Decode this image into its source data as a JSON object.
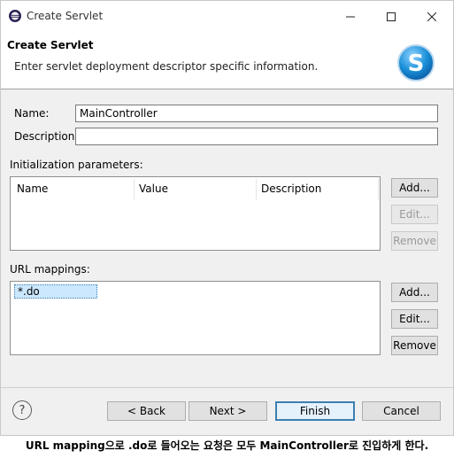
{
  "window": {
    "title": "Create Servlet",
    "controls": {
      "minimize": "—",
      "maximize": "☐",
      "close": "✕"
    }
  },
  "banner": {
    "title": "Create Servlet",
    "description": "Enter servlet deployment descriptor specific information.",
    "logo_letter": "S"
  },
  "form": {
    "name_label": "Name:",
    "name_value": "MainController",
    "description_label": "Description:",
    "description_value": ""
  },
  "init_params": {
    "label": "Initialization parameters:",
    "columns": [
      "Name",
      "Value",
      "Description"
    ],
    "buttons": {
      "add": "Add...",
      "edit": "Edit...",
      "remove": "Remove"
    }
  },
  "url_mappings": {
    "label": "URL mappings:",
    "items": [
      "*.do"
    ],
    "buttons": {
      "add": "Add...",
      "edit": "Edit...",
      "remove": "Remove"
    }
  },
  "footer": {
    "help": "?",
    "back": "< Back",
    "next": "Next >",
    "finish": "Finish",
    "cancel": "Cancel"
  },
  "caption": "URL mapping으로 .do로 들어오는 요청은 모두 MainController로 진입하게 한다.",
  "colors": {
    "accent": "#3c7fb1",
    "logo_blue": "#1a8fd8",
    "selection": "#cce8ff"
  }
}
